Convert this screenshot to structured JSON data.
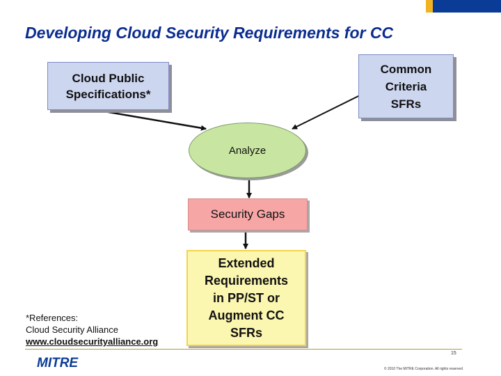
{
  "title": "Developing Cloud Security Requirements for CC",
  "nodes": {
    "cloud_specs": [
      "Cloud Public",
      "Specifications*"
    ],
    "cc_sfrs": [
      "Common",
      "Criteria",
      "SFRs"
    ],
    "analyze": "Analyze",
    "security_gaps": "Security Gaps",
    "extended": [
      "Extended",
      "Requirements",
      "in PP/ST or",
      "Augment CC",
      "SFRs"
    ]
  },
  "references": {
    "heading": "*References:",
    "source": "Cloud Security Alliance",
    "link": "www.cloudsecurityalliance.org"
  },
  "footer": {
    "logo": "MITRE",
    "page_number": "15",
    "copyright": "© 2010 The MITRE Corporation. All rights reserved"
  },
  "colors": {
    "title": "#0a2c8f",
    "input_box": "#cdd6ef",
    "analyze": "#c8e6a2",
    "gaps": "#f7a6a6",
    "extended": "#fbf6b0",
    "accent_blue": "#0a3b96",
    "accent_gold": "#f2b322"
  }
}
